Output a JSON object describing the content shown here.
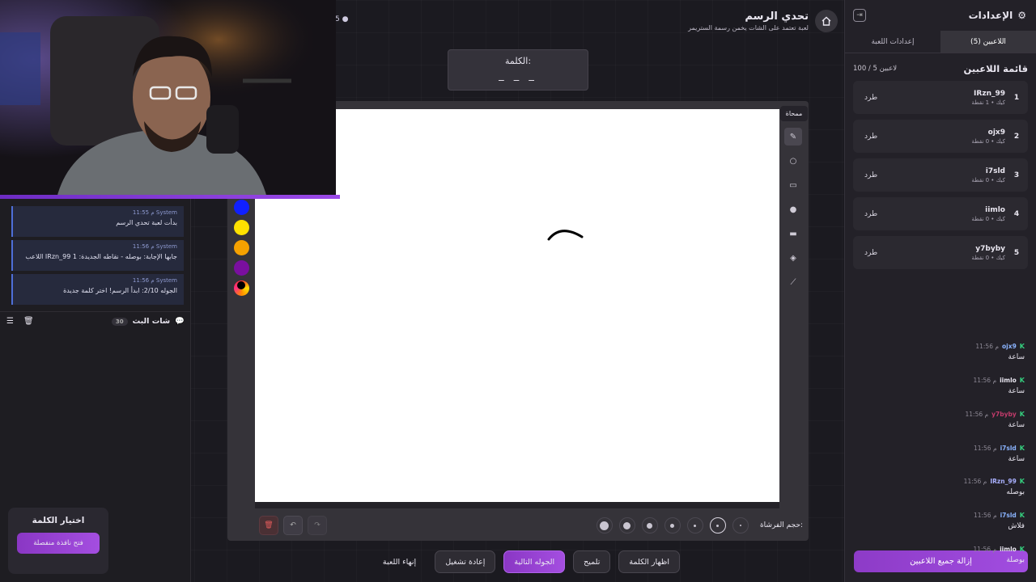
{
  "header": {
    "title": "تحدي الرسم",
    "subtitle": "لعبة تعتمد على الشات يخمن رسمة الستريمر",
    "online_count": "5"
  },
  "word": {
    "label": "الكلمة:",
    "blanks": "_ _ _"
  },
  "tooltip": "ممحاة",
  "palette": [
    "#1020ff",
    "#ffe100",
    "#f5a100",
    "#7a0f9f"
  ],
  "brush": {
    "label": "حجم الفرشاة:"
  },
  "actions": {
    "show_word": "اظهار الكلمة",
    "hint": "تلميح",
    "next_round": "الجوله التالية",
    "restart": "إعادة تشغيل",
    "end_game": "إنهاء اللعبة"
  },
  "settings": {
    "title": "الإعدادات",
    "tab_players": "اللاعبين (5)",
    "tab_game": "إعدادات اللعبة",
    "list_title": "قائمة اللاعبين",
    "list_count": "100 / 5 لاعبين",
    "kick_label": "طرد",
    "remove_all": "إزالة جميع اللاعبين",
    "players": [
      {
        "num": "1",
        "name": "IRzn_99",
        "sub": "كيك • 1 نقطة"
      },
      {
        "num": "2",
        "name": "ojx9",
        "sub": "كيك • 0 نقطة"
      },
      {
        "num": "3",
        "name": "i7sld",
        "sub": "كيك • 0 نقطة"
      },
      {
        "num": "4",
        "name": "iimlo",
        "sub": "كيك • 0 نقطة"
      },
      {
        "num": "5",
        "name": "y7byby",
        "sub": "كيك • 0 نقطة"
      }
    ]
  },
  "system_messages": [
    {
      "top": "11:55 م  System",
      "text": "بدأت لعبة تحدي الرسم"
    },
    {
      "top": "11:56 م  System",
      "text": "اللاعب IRzn_99 جابها الإجابة: بوصله - نقاطه الجديدة: 1"
    },
    {
      "top": "11:56 م  System",
      "text": "الجوله 2/10: ابدأ الرسم! اختر كلمة جديدة"
    }
  ],
  "chat": {
    "title": "شات البث",
    "count": "30",
    "messages": [
      {
        "user": "ojx9",
        "time": "11:56 م",
        "text": "ساعة",
        "color": "#8ab4ff"
      },
      {
        "user": "iimlo",
        "time": "11:56 م",
        "text": "ساعة",
        "color": "#e9e6f0"
      },
      {
        "user": "y7byby",
        "time": "11:56 م",
        "text": "ساعة",
        "color": "#c23b6b"
      },
      {
        "user": "i7sld",
        "time": "11:56 م",
        "text": "ساعة",
        "color": "#8ab4ff"
      },
      {
        "user": "IRzn_99",
        "time": "11:56 م",
        "text": "بوصله",
        "color": "#a9b0ff"
      },
      {
        "user": "i7sld",
        "time": "11:56 م",
        "text": "فلاش",
        "color": "#8ab4ff"
      },
      {
        "user": "iimlo",
        "time": "11:56 م",
        "text": "بوصلة",
        "color": "#e9e6f0"
      }
    ]
  },
  "pick_word": {
    "title": "اختيار الكلمة",
    "button": "فتح نافذة منفصلة"
  }
}
